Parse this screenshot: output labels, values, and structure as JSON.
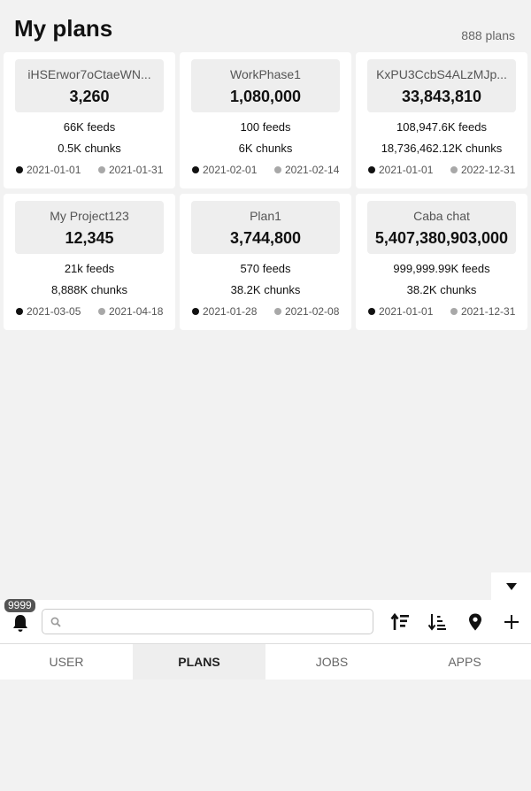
{
  "header": {
    "title": "My plans",
    "count_label": "888 plans"
  },
  "plans": [
    {
      "name": "iHSErwor7oCtaeWN...",
      "total": "3,260",
      "feeds": "66K feeds",
      "chunks": "0.5K chunks",
      "start": "2021-01-01",
      "end": "2021-01-31"
    },
    {
      "name": "WorkPhase1",
      "total": "1,080,000",
      "feeds": "100 feeds",
      "chunks": "6K chunks",
      "start": "2021-02-01",
      "end": "2021-02-14"
    },
    {
      "name": "KxPU3CcbS4ALzMJp...",
      "total": "33,843,810",
      "feeds": "108,947.6K feeds",
      "chunks": "18,736,462.12K chunks",
      "start": "2021-01-01",
      "end": "2022-12-31"
    },
    {
      "name": "My Project123",
      "total": "12,345",
      "feeds": "21k feeds",
      "chunks": "8,888K chunks",
      "start": "2021-03-05",
      "end": "2021-04-18"
    },
    {
      "name": "Plan1",
      "total": "3,744,800",
      "feeds": "570 feeds",
      "chunks": "38.2K chunks",
      "start": "2021-01-28",
      "end": "2021-02-08"
    },
    {
      "name": "Caba chat",
      "total": "5,407,380,903,000",
      "feeds": "999,999.99K feeds",
      "chunks": "38.2K chunks",
      "start": "2021-01-01",
      "end": "2021-12-31"
    }
  ],
  "toolbar": {
    "notification_count": "9999",
    "search_placeholder": "",
    "search_value": ""
  },
  "icons": {
    "collapse": "caret-down-icon",
    "bell": "bell-icon",
    "search": "search-icon",
    "sort_asc": "sort-ascending-icon",
    "sort_desc": "sort-descending-icon",
    "location": "map-pin-icon",
    "add": "plus-icon"
  },
  "tabs": [
    {
      "label": "USER",
      "active": false
    },
    {
      "label": "PLANS",
      "active": true
    },
    {
      "label": "JOBS",
      "active": false
    },
    {
      "label": "APPS",
      "active": false
    }
  ],
  "colors": {
    "background": "#f2f2f2",
    "card": "#ffffff",
    "start_dot": "#111111",
    "end_dot": "#a8a8a8"
  }
}
